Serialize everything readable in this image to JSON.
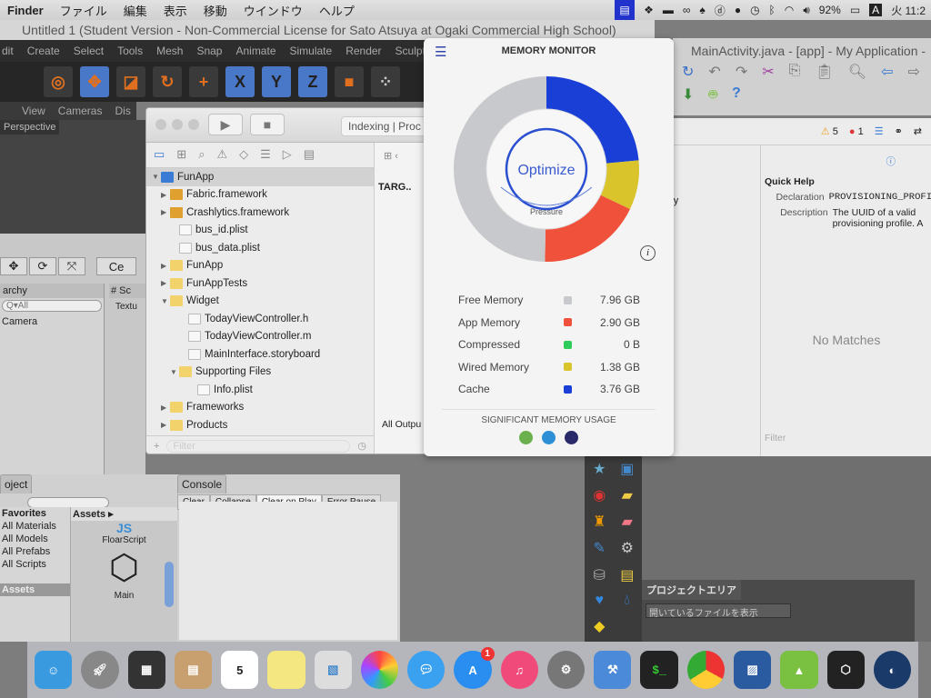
{
  "menubar": {
    "app": "Finder",
    "items": [
      "ファイル",
      "編集",
      "表示",
      "移動",
      "ウインドウ",
      "ヘルプ"
    ],
    "battery": "92%",
    "clock": "火 11:2",
    "input": "A"
  },
  "maya": {
    "title": "Untitled 1 (Student Version - Non-Commercial License for Sato Atsuya at Ogaki Commercial High School)",
    "menus": [
      "dit",
      "Create",
      "Select",
      "Tools",
      "Mesh",
      "Snap",
      "Animate",
      "Simulate",
      "Render",
      "Sculpt"
    ],
    "axes": [
      "X",
      "Y",
      "Z"
    ],
    "view_menus": [
      "View",
      "Cameras",
      "Dis"
    ],
    "viewport_label": "Perspective"
  },
  "unity": {
    "center_btn": "Ce",
    "hierarchy_tab": "archy",
    "hierarchy_search": "Q▾All",
    "hierarchy_items": [
      "Camera"
    ],
    "scene_tab": "# Sc",
    "scene_sub": "Textu",
    "project_tab": "oject",
    "favorites_title": "Favorites",
    "favorites": [
      "All Materials",
      "All Models",
      "All Prefabs",
      "All Scripts"
    ],
    "assets_root": "Assets",
    "assets_header": "Assets ▸",
    "assets": [
      "FloarScript",
      "Main"
    ],
    "console_tab": "Console",
    "console_buttons": [
      "Clear",
      "Collapse",
      "Clear on Play",
      "Error Pause"
    ]
  },
  "xcode": {
    "status": "Indexing | Proc",
    "tree": [
      {
        "label": "FunApp",
        "icon": "proj",
        "indent": 0,
        "tri": "▼",
        "sel": true
      },
      {
        "label": "Fabric.framework",
        "icon": "brief",
        "indent": 1,
        "tri": "▶"
      },
      {
        "label": "Crashlytics.framework",
        "icon": "brief",
        "indent": 1,
        "tri": "▶"
      },
      {
        "label": "bus_id.plist",
        "icon": "file",
        "indent": 2,
        "tri": ""
      },
      {
        "label": "bus_data.plist",
        "icon": "file",
        "indent": 2,
        "tri": ""
      },
      {
        "label": "FunApp",
        "icon": "fold",
        "indent": 1,
        "tri": "▶"
      },
      {
        "label": "FunAppTests",
        "icon": "fold",
        "indent": 1,
        "tri": "▶"
      },
      {
        "label": "Widget",
        "icon": "fold",
        "indent": 1,
        "tri": "▼"
      },
      {
        "label": "TodayViewController.h",
        "icon": "file",
        "indent": 3,
        "tri": ""
      },
      {
        "label": "TodayViewController.m",
        "icon": "file",
        "indent": 3,
        "tri": ""
      },
      {
        "label": "MainInterface.storyboard",
        "icon": "file",
        "indent": 3,
        "tri": ""
      },
      {
        "label": "Supporting Files",
        "icon": "fold",
        "indent": 2,
        "tri": "▼"
      },
      {
        "label": "Info.plist",
        "icon": "file",
        "indent": 4,
        "tri": ""
      },
      {
        "label": "Frameworks",
        "icon": "fold",
        "indent": 1,
        "tri": "▶"
      },
      {
        "label": "Products",
        "icon": "fold",
        "indent": 1,
        "tri": "▶"
      }
    ],
    "filter_placeholder": "Filter",
    "targets_label": "TARG..",
    "all_output": "All Outpu",
    "warnings": "5",
    "errors": "1",
    "ory": "ory",
    "quick_help": "Quick Help",
    "declaration_key": "Declaration",
    "declaration_val": "PROVISIONING_PROFI",
    "description_key": "Description",
    "description_val": "The UUID of a valid provisioning profile. A",
    "no_matches": "No Matches",
    "filter2": "Filter"
  },
  "android": {
    "title": "MainActivity.java - [app] - My Application -"
  },
  "memory_monitor": {
    "title": "MEMORY MONITOR",
    "optimize": "Optimize",
    "pressure": "Pressure",
    "significant": "SIGNIFICANT MEMORY USAGE",
    "items": [
      {
        "label": "Free Memory",
        "value": "7.96 GB",
        "gb": 7.96,
        "color": "#c8c9cc"
      },
      {
        "label": "App Memory",
        "value": "2.90 GB",
        "gb": 2.9,
        "color": "#f0513a"
      },
      {
        "label": "Compressed",
        "value": "0 B",
        "gb": 0,
        "color": "#2ecc5a"
      },
      {
        "label": "Wired Memory",
        "value": "1.38 GB",
        "gb": 1.38,
        "color": "#d9c42c"
      },
      {
        "label": "Cache",
        "value": "3.76 GB",
        "gb": 3.76,
        "color": "#1a3fd6"
      }
    ],
    "sig_app_colors": [
      "#6ab04c",
      "#2d8fd6",
      "#2a2a6a"
    ]
  },
  "photoshop": {
    "project_area": "プロジェクトエリア",
    "dropdown": "開いているファイルを表示"
  },
  "dock": {
    "calendar_day": "5",
    "appstore_badge": "1",
    "terminal": "$_"
  }
}
